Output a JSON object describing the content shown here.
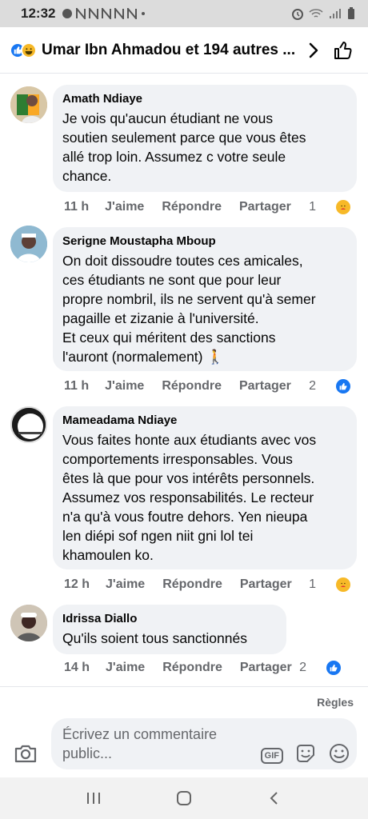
{
  "status_bar": {
    "time": "12:32",
    "notif_icons": [
      "N",
      "N",
      "N",
      "N",
      "N"
    ]
  },
  "header": {
    "title": "Umar Ibn Ahmadou et 194 autres ..."
  },
  "comments": [
    {
      "author": "Amath Ndiaye",
      "text": "Je vois qu'aucun étudiant ne vous\nsoutien seulement parce que vous êtes\nallé trop loin. Assumez c votre seule\nchance.",
      "time": "11 h",
      "like": "J'aime",
      "reply": "Répondre",
      "share": "Partager",
      "reaction_count": "1",
      "reaction": "care"
    },
    {
      "author": "Serigne Moustapha Mboup",
      "text": "On doit dissoudre toutes ces amicales,\nces étudiants ne sont que pour leur\npropre nombril, ils ne servent qu'à semer\npagaille et zizanie à l'université.\nEt ceux qui méritent des sanctions\nl'auront (normalement) 🚶",
      "time": "11 h",
      "like": "J'aime",
      "reply": "Répondre",
      "share": "Partager",
      "reaction_count": "2",
      "reaction": "like"
    },
    {
      "author": "Mameadama Ndiaye",
      "text": "Vous faites honte aux étudiants avec vos\ncomportements irresponsables. Vous\nêtes là que pour vos intérêts personnels.\nAssumez vos responsabilités. Le recteur\nn'a qu'à vous foutre dehors. Yen nieupa\nlen diépi sof ngen niit gni lol tei\nkhamoulen ko.",
      "time": "12 h",
      "like": "J'aime",
      "reply": "Répondre",
      "share": "Partager",
      "reaction_count": "1",
      "reaction": "care"
    },
    {
      "author": "Idrissa Diallo",
      "text": "Qu'ils soient tous sanctionnés",
      "time": "14 h",
      "like": "J'aime",
      "reply": "Répondre",
      "share": "Partager",
      "reaction_count": "2",
      "reaction": "like"
    }
  ],
  "rules_link": "Règles",
  "composer": {
    "placeholder": "Écrivez un commentaire public...",
    "gif_label": "GIF"
  },
  "colors": {
    "accent": "#1877f2",
    "bubble": "#f0f2f5",
    "muted": "#65676b"
  }
}
